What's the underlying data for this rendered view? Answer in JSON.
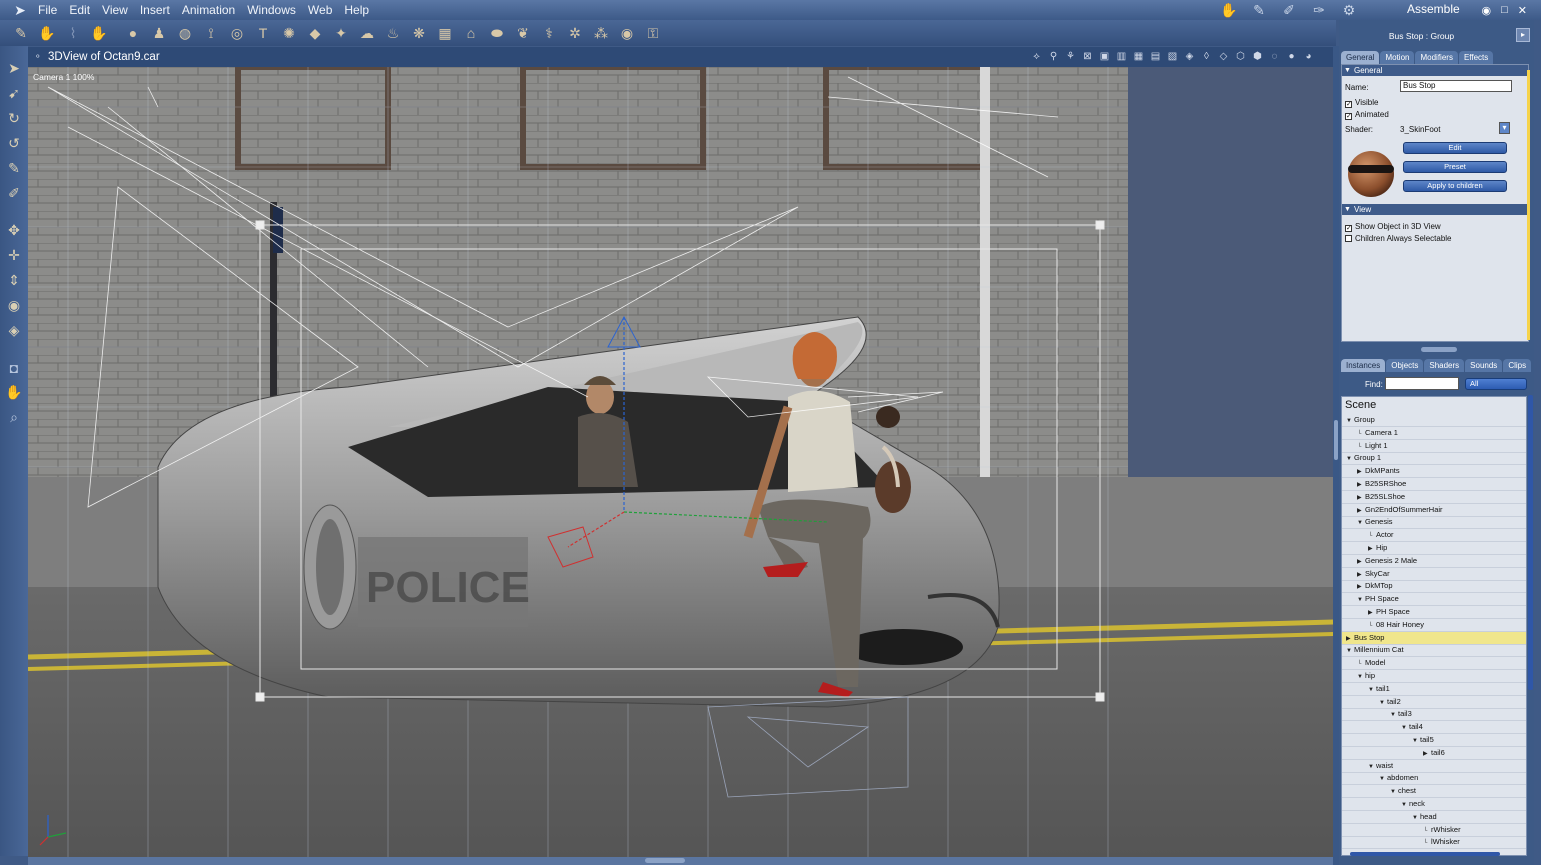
{
  "menubar": {
    "items": [
      "File",
      "Edit",
      "View",
      "Insert",
      "Animation",
      "Windows",
      "Web",
      "Help"
    ],
    "room": "Assemble",
    "window_controls": [
      "◉",
      "□",
      "✕"
    ]
  },
  "viewport": {
    "title": "3DView of Octan9.car",
    "camera_label": "Camera 1 100%"
  },
  "props": {
    "title": "Bus Stop : Group",
    "tabs": [
      "General",
      "Motion",
      "Modifiers",
      "Effects"
    ],
    "general_header": "General",
    "name_label": "Name:",
    "name_value": "Bus Stop",
    "visible_label": "Visible",
    "animated_label": "Animated",
    "shader_label": "Shader:",
    "shader_value": "3_SkinFoot",
    "edit_button": "Edit",
    "preset_button": "Preset",
    "apply_button": "Apply to children",
    "view_header": "View",
    "show_object_label": "Show Object in 3D View",
    "children_selectable_label": "Children Always Selectable"
  },
  "library": {
    "tabs": [
      "Instances",
      "Objects",
      "Shaders",
      "Sounds",
      "Clips"
    ],
    "find_label": "Find:",
    "find_filter": "All",
    "scene_label": "Scene",
    "tree": [
      {
        "label": "Group",
        "indent": 0,
        "arrow": "down"
      },
      {
        "label": "Camera 1",
        "indent": 1,
        "arrow": "none"
      },
      {
        "label": "Light 1",
        "indent": 1,
        "arrow": "none"
      },
      {
        "label": "Group 1",
        "indent": 0,
        "arrow": "down"
      },
      {
        "label": "DkMPants",
        "indent": 1,
        "arrow": "right"
      },
      {
        "label": "B25SRShoe",
        "indent": 1,
        "arrow": "right"
      },
      {
        "label": "B25SLShoe",
        "indent": 1,
        "arrow": "right"
      },
      {
        "label": "Gn2EndOfSummerHair",
        "indent": 1,
        "arrow": "right"
      },
      {
        "label": "Genesis",
        "indent": 1,
        "arrow": "down"
      },
      {
        "label": "Actor",
        "indent": 2,
        "arrow": "none"
      },
      {
        "label": "Hip",
        "indent": 2,
        "arrow": "right"
      },
      {
        "label": "Genesis 2 Male",
        "indent": 1,
        "arrow": "right"
      },
      {
        "label": "SkyCar",
        "indent": 1,
        "arrow": "right"
      },
      {
        "label": "DkMTop",
        "indent": 1,
        "arrow": "right"
      },
      {
        "label": "PH Space",
        "indent": 1,
        "arrow": "down"
      },
      {
        "label": "PH Space",
        "indent": 2,
        "arrow": "right"
      },
      {
        "label": "08 Hair Honey",
        "indent": 2,
        "arrow": "none"
      },
      {
        "label": "Bus Stop",
        "indent": 0,
        "arrow": "right",
        "selected": true
      },
      {
        "label": "Millennium Cat",
        "indent": 0,
        "arrow": "down"
      },
      {
        "label": "Model",
        "indent": 1,
        "arrow": "none"
      },
      {
        "label": "hip",
        "indent": 1,
        "arrow": "down"
      },
      {
        "label": "tail1",
        "indent": 2,
        "arrow": "down"
      },
      {
        "label": "tail2",
        "indent": 3,
        "arrow": "down"
      },
      {
        "label": "tail3",
        "indent": 4,
        "arrow": "down"
      },
      {
        "label": "tail4",
        "indent": 5,
        "arrow": "down"
      },
      {
        "label": "tail5",
        "indent": 6,
        "arrow": "down"
      },
      {
        "label": "tail6",
        "indent": 7,
        "arrow": "right"
      },
      {
        "label": "waist",
        "indent": 2,
        "arrow": "down"
      },
      {
        "label": "abdomen",
        "indent": 3,
        "arrow": "down"
      },
      {
        "label": "chest",
        "indent": 4,
        "arrow": "down"
      },
      {
        "label": "neck",
        "indent": 5,
        "arrow": "down"
      },
      {
        "label": "head",
        "indent": 6,
        "arrow": "down"
      },
      {
        "label": "rWhisker",
        "indent": 7,
        "arrow": "none"
      },
      {
        "label": "lWhisker",
        "indent": 7,
        "arrow": "none"
      }
    ]
  },
  "icons": {
    "toolbar": [
      "select-icon",
      "pan-icon",
      "brush-icon",
      "hand-icon",
      "sphere-icon",
      "figure-icon",
      "globe-icon",
      "bone-icon",
      "target-icon",
      "text-icon",
      "gear-icon",
      "plane-icon",
      "light-icon",
      "cloud-icon",
      "drop-icon",
      "particles-icon",
      "grid-icon",
      "house-icon",
      "blob-icon",
      "leaf-icon",
      "wand-icon",
      "spider-icon",
      "nodes-icon",
      "ring-icon",
      "key-icon"
    ],
    "left": [
      "arrow-select-icon",
      "arrow-direct-icon",
      "rotate-icon",
      "twist-icon",
      "pencil-icon",
      "paint-icon",
      "move-icon",
      "move-xz-icon",
      "move-y-icon",
      "orbit-icon",
      "scale-icon",
      "camera-icon",
      "hand-pan-icon",
      "zoom-icon"
    ]
  },
  "colors": {
    "accent": "#3e5b8a",
    "selection": "#f0e68c",
    "button": "#2f5aa6"
  }
}
